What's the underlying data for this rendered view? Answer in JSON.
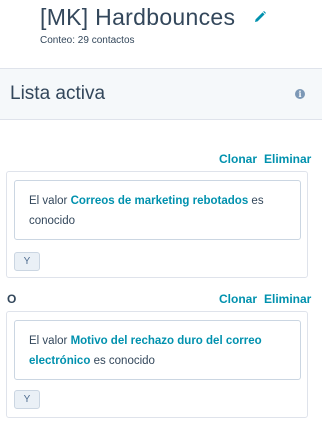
{
  "header": {
    "title": "[MK] Hardbounces",
    "count": "Conteo: 29 contactos"
  },
  "list": {
    "status": "Lista activa"
  },
  "or_label": "O",
  "groups": [
    {
      "clone_label": "Clonar",
      "delete_label": "Eliminar",
      "filter": {
        "prefix": "El valor",
        "property": "Correos de marketing rebotados",
        "suffix": "es conocido"
      },
      "and_label": "Y"
    },
    {
      "clone_label": "Clonar",
      "delete_label": "Eliminar",
      "filter": {
        "prefix": "El valor",
        "property": "Motivo del rechazo duro del correo electrónico",
        "suffix": "es conocido"
      },
      "and_label": "Y"
    }
  ],
  "icons": {
    "edit": "pencil-icon",
    "info": "info-icon"
  },
  "colors": {
    "link": "#0091ae",
    "text": "#33475b",
    "panel_bg": "#f5f8fa"
  }
}
